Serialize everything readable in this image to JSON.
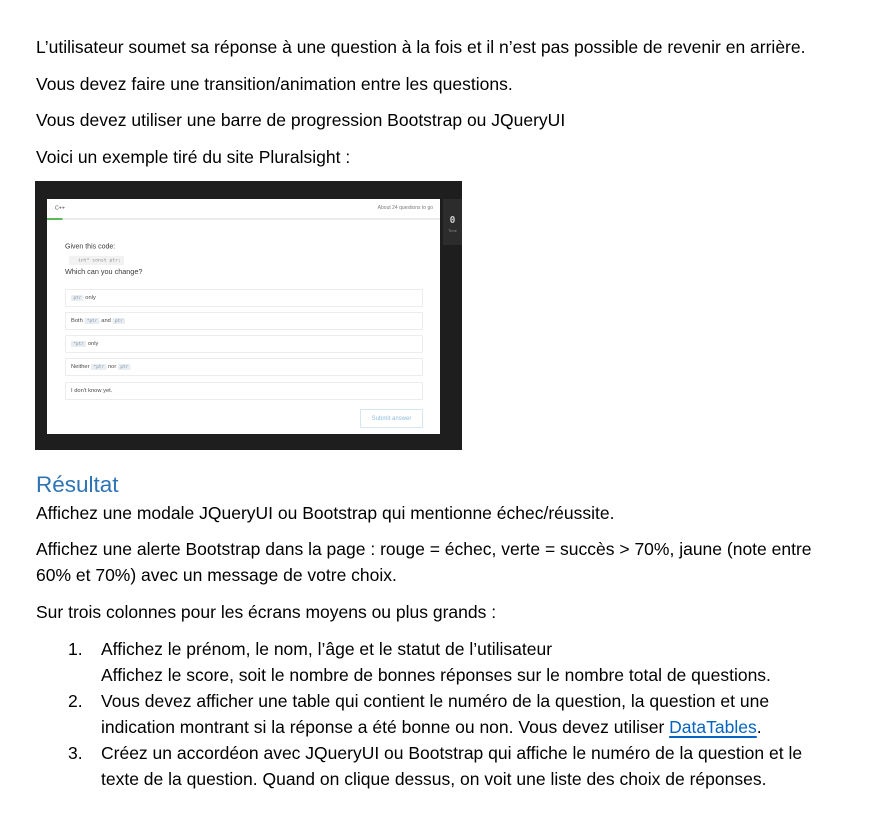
{
  "document": {
    "intro_paragraphs": [
      "L’utilisateur soumet sa réponse à une question à la fois et il n’est pas possible de revenir en arrière.",
      "Vous devez faire une transition/animation entre les questions.",
      "Vous devez utiliser une barre de progression Bootstrap ou JQueryUI",
      "Voici un exemple tiré du site Pluralsight :"
    ],
    "example_screenshot": {
      "course": "C++",
      "remaining": "About 24 questions to go",
      "progress_fraction": 0.04,
      "timer_value": "0",
      "timer_label": "Time",
      "prompt": "Given this code:",
      "code": "int* const ptr;",
      "question": "Which can you change?",
      "options": [
        [
          {
            "code": "ptr"
          },
          {
            "text": " only"
          }
        ],
        [
          {
            "text": "Both "
          },
          {
            "code": "*ptr"
          },
          {
            "text": " and "
          },
          {
            "code": "ptr"
          }
        ],
        [
          {
            "code": "*ptr"
          },
          {
            "text": " only"
          }
        ],
        [
          {
            "text": "Neither "
          },
          {
            "code": "*ptr"
          },
          {
            "text": " nor "
          },
          {
            "code": "ptr"
          }
        ],
        [
          {
            "text": "I don't know yet."
          }
        ]
      ],
      "submit_label": "Submit answer"
    },
    "result": {
      "heading": "Résultat",
      "paragraphs": [
        [
          "Affichez une modale JQueryUI ou Bootstrap qui mentionne échec/réussite."
        ],
        [
          "Affichez une alerte Bootstrap dans la page : rouge = échec, verte = succès > 70%, jaune (note entre",
          "60% et 70%) avec un message de votre choix."
        ],
        [
          "Sur trois colonnes pour les écrans moyens ou plus grands :"
        ]
      ],
      "list": [
        {
          "number": "1.",
          "lines": [
            "Affichez le prénom, le nom, l’âge et le statut de l’utilisateur",
            "Affichez le score, soit le nombre de bonnes réponses sur le nombre total de questions."
          ]
        },
        {
          "number": "2.",
          "lines": [
            "Vous devez afficher une table qui contient le numéro de la question, la question et une",
            "indication montrant si la réponse a été bonne ou non. Vous devez utiliser "
          ],
          "link": "DataTables",
          "after_link": "."
        },
        {
          "number": "3.",
          "lines": [
            "Créez un accordéon avec JQueryUI ou Bootstrap qui affiche le numéro de la question et le",
            "texte de la question. Quand on clique dessus, on voit une liste des choix de réponses."
          ]
        }
      ]
    }
  },
  "colors": {
    "heading": "#2e74b5",
    "link": "#0563c1",
    "progress": "#5cb85c",
    "submit": "#8dbde0",
    "frame": "#1e1e1e"
  }
}
